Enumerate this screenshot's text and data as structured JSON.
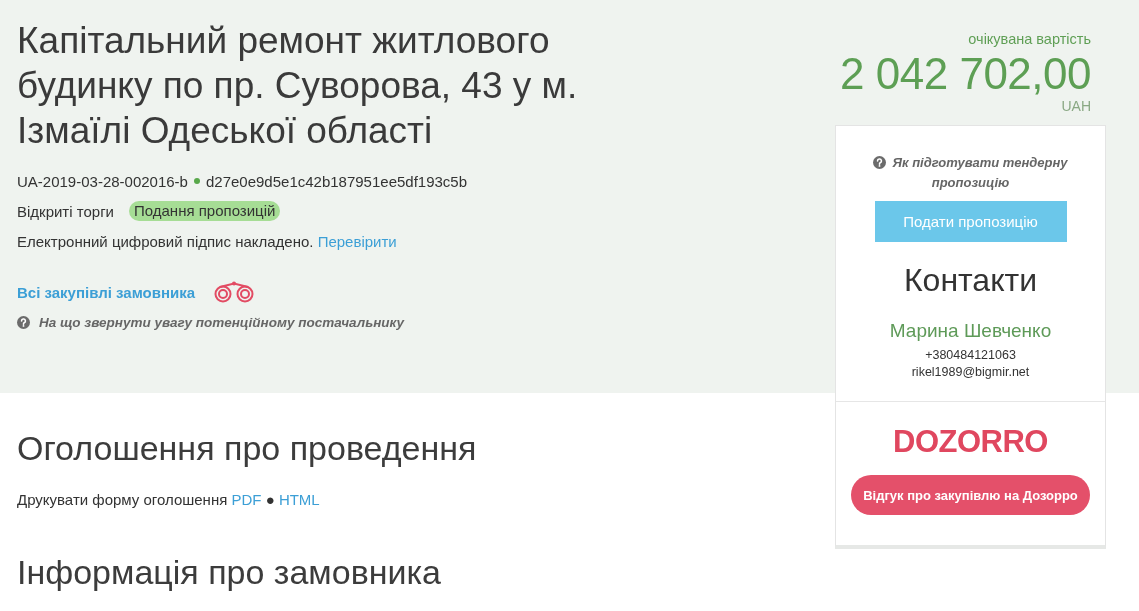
{
  "tender": {
    "title": "Капітальний ремонт житлового будинку по пр. Суворова, 43 у м. Ізмаїлі Одеської області",
    "tender_id": "UA-2019-03-28-002016-b",
    "hash": "d27e0e9d5e1c42b187951ee5df193c5b",
    "procedure": "Відкриті торги",
    "status": "Подання пропозицій",
    "signature": {
      "text": "Електронний цифровий підпис накладено.",
      "link": "Перевірити"
    },
    "buyer_link": "Всі закупівлі замовника",
    "hint": "На що звернути увагу потенційному постачальнику"
  },
  "value": {
    "label": "очікувана вартість",
    "amount": "2 042 702,00",
    "currency": "UAH"
  },
  "sidebar": {
    "hint": "Як підготувати тендерну пропозицію",
    "submit_button": "Подати пропозицію",
    "contacts": {
      "heading": "Контакти",
      "name": "Марина Шевченко",
      "phone": "+380484121063",
      "email": "rikel1989@bigmir.net"
    },
    "logo": "DOZORRO",
    "feedback_button": "Відгук про закупівлю на Дозорро"
  },
  "sections": [
    {
      "heading": "Оголошення про проведення",
      "print": {
        "label": "Друкувати форму оголошення",
        "links": [
          "PDF",
          "HTML"
        ],
        "separator": "●"
      }
    },
    {
      "heading": "Інформація про замовника"
    }
  ]
}
